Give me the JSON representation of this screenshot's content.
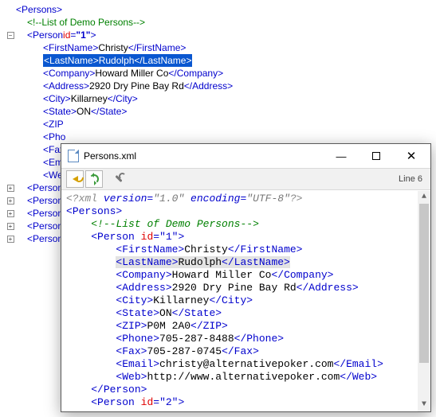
{
  "tree": {
    "root": "Persons",
    "comment": "List of Demo Persons",
    "person1": {
      "open_tag": "Person",
      "id_attr": "id",
      "id_val": "\"1\"",
      "fields": {
        "FirstName": "Christy",
        "LastName": "Rudolph",
        "Company": "Howard Miller Co",
        "Address": "2920 Dry Pine Bay Rd",
        "City": "Killarney",
        "State": "ON",
        "ZIP": "",
        "Pho": "",
        "Fax": "",
        "Ema": "",
        "We": ""
      }
    },
    "collapsed": [
      "Person",
      "Person",
      "Person",
      "Person",
      "Person"
    ]
  },
  "popup": {
    "title": "Persons.xml",
    "line_label": "Line 6",
    "xml_decl": {
      "pre": "<?xml ",
      "ver_k": "version=",
      "ver_v": "\"1.0\"",
      "enc_k": " encoding=",
      "enc_v": "\"UTF-8\"",
      "post": "?>"
    },
    "lines": {
      "persons_open": "Persons",
      "comment": "List of Demo Persons",
      "person_open": {
        "tag": "Person",
        "attr": "id",
        "val": "\"1\""
      },
      "FirstName": "Christy",
      "LastName": "Rudolph",
      "Company": "Howard Miller Co",
      "Address": "2920 Dry Pine Bay Rd",
      "City": "Killarney",
      "State": "ON",
      "ZIP": "P0M 2A0",
      "Phone": "705-287-8488",
      "Fax": "705-287-0745",
      "Email": "christy@alternativepoker.com",
      "Web": "http://www.alternativepoker.com",
      "person_close": "Person",
      "person2": {
        "tag": "Person",
        "attr": "id",
        "val": "\"2\""
      }
    }
  }
}
